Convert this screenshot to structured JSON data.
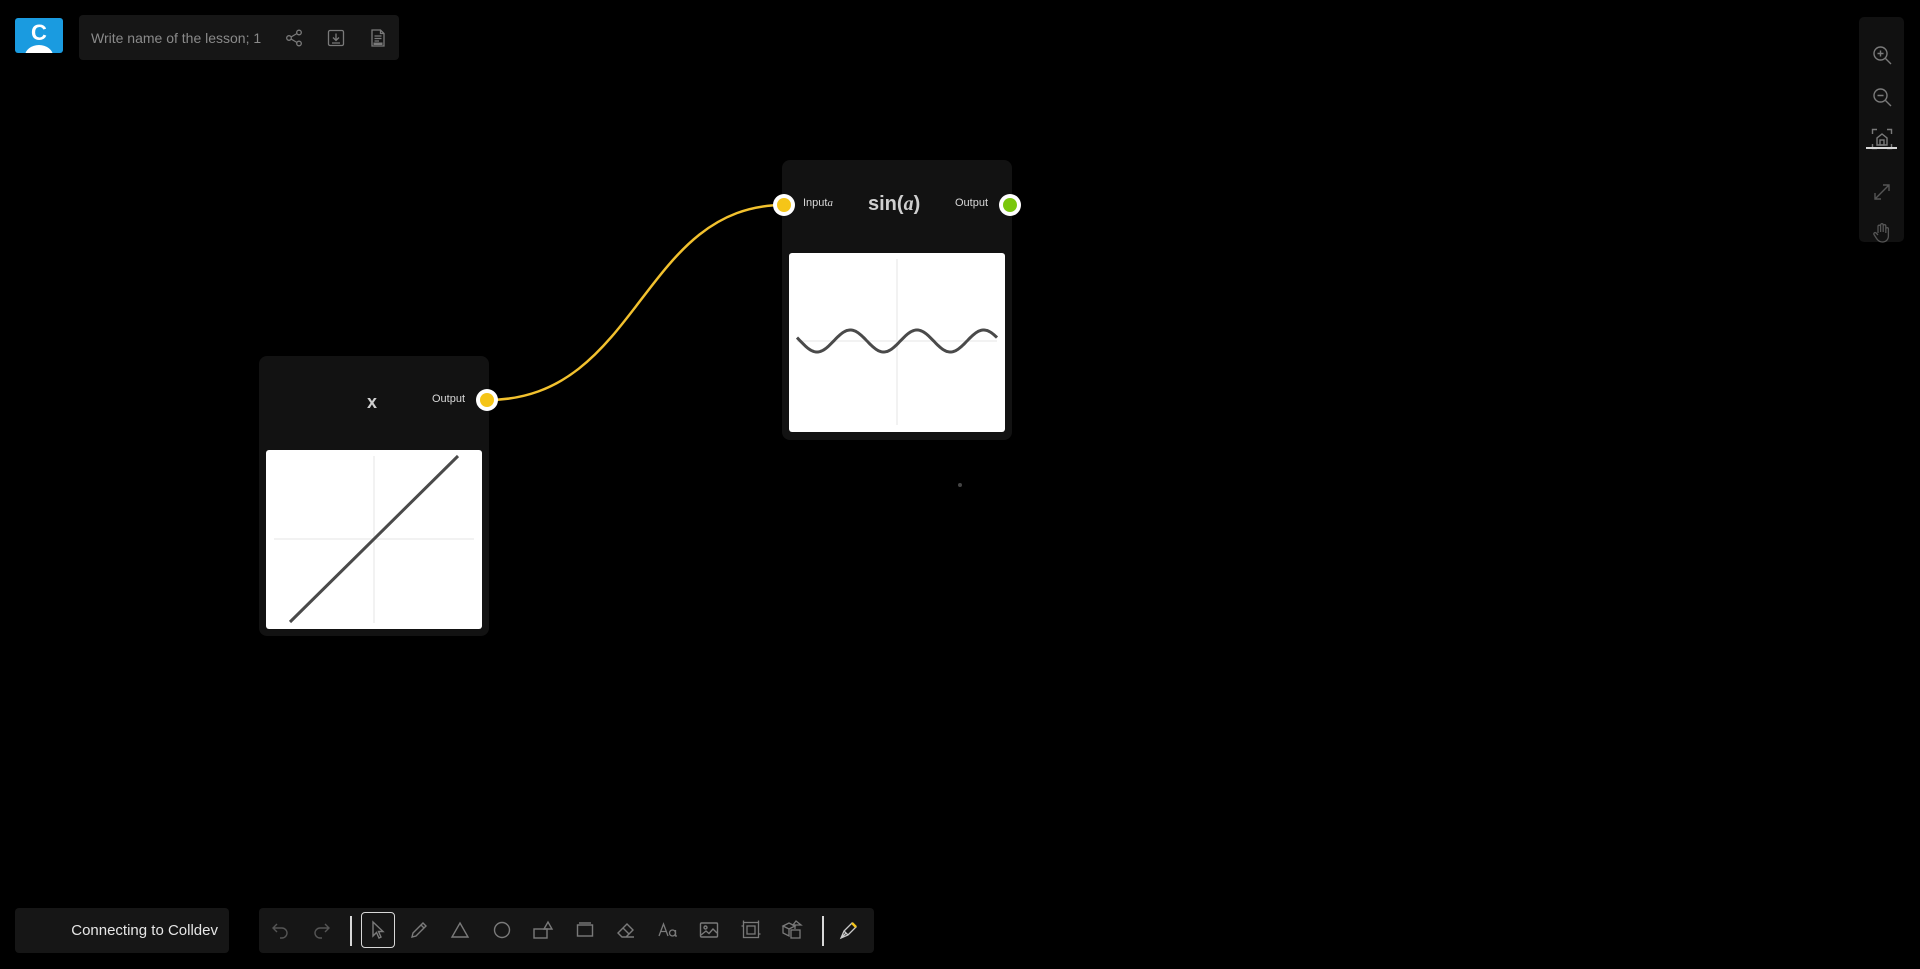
{
  "header": {
    "lesson_name_placeholder": "Write name of the lesson; 1",
    "icons": [
      "share-icon",
      "download-icon",
      "pdf-icon"
    ]
  },
  "logo": {
    "letter": "C"
  },
  "right_toolbar": {
    "icons": [
      "zoom-in-icon",
      "zoom-out-icon",
      "fit-to-screen-icon",
      "expand-icon",
      "hand-icon"
    ]
  },
  "nodes": [
    {
      "title": "x",
      "output_label": "Output",
      "output_color": "#f5c518",
      "plot": {
        "function": "y = x"
      }
    },
    {
      "title_fn": "sin(",
      "title_var": "a",
      "title_end": ")",
      "input_label": "Input",
      "input_var": "a",
      "input_color": "#f5c518",
      "output_label": "Output",
      "output_color": "#7ac70c",
      "plot": {
        "function": "y = sin(a)"
      }
    }
  ],
  "connection": {
    "from": "x.Output",
    "to": "sin(a).Input a",
    "color": "#f2c12e"
  },
  "status": {
    "text": "Connecting to Colldev"
  },
  "bottom_toolbar": {
    "tools": [
      "undo-icon",
      "redo-icon",
      "select-icon",
      "pencil-icon",
      "triangle-icon",
      "circle-icon",
      "shapes-icon",
      "rectangle-icon",
      "eraser-icon",
      "text-icon",
      "image-icon",
      "frame-icon",
      "3d-shapes-icon",
      "pen-icon"
    ],
    "active_tool": "select-icon"
  }
}
